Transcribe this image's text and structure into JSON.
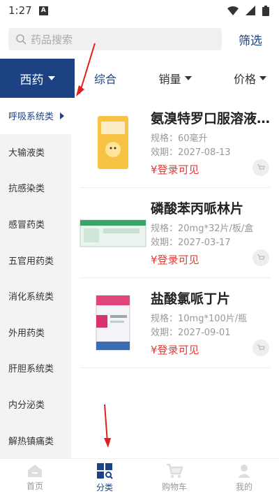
{
  "status": {
    "time": "1:27",
    "notif_letter": "A"
  },
  "search": {
    "placeholder": "药品搜索"
  },
  "filter_label": "筛选",
  "category_tab": "西药",
  "sort_tabs": [
    "综合",
    "销量",
    "价格"
  ],
  "sidebar": {
    "items": [
      "呼吸系统类",
      "大输液类",
      "抗感染类",
      "感冒药类",
      "五官用药类",
      "消化系统类",
      "外用药类",
      "肝胆系统类",
      "内分泌类",
      "解热镇痛类"
    ]
  },
  "products": [
    {
      "name": "氨溴特罗口服溶液...",
      "spec": "规格：60毫升",
      "expiry": "效期：2027-08-13",
      "price": "¥登录可见"
    },
    {
      "name": "磷酸苯丙哌林片",
      "spec": "规格：20mg*32片/板/盒",
      "expiry": "效期：2027-03-17",
      "price": "¥登录可见"
    },
    {
      "name": "盐酸氯哌丁片",
      "spec": "规格：10mg*100片/瓶",
      "expiry": "效期：2027-09-01",
      "price": "¥登录可见"
    }
  ],
  "bottom_nav": [
    "首页",
    "分类",
    "购物车",
    "我的"
  ],
  "colors": {
    "accent": "#1c4283",
    "price": "#e53935",
    "annotation_arrow": "#e02020"
  }
}
